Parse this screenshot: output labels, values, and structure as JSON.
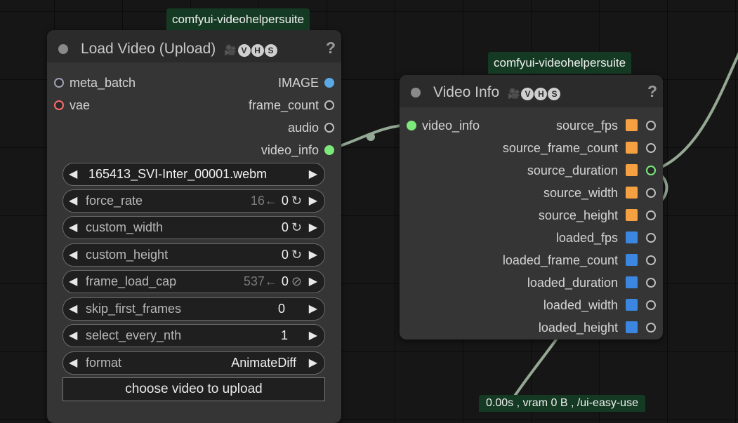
{
  "node_load": {
    "badge": "comfyui-videohelpersuite",
    "title": "Load Video (Upload)",
    "help": "?",
    "vhs_letters": [
      "V",
      "H",
      "S"
    ],
    "inputs": [
      "meta_batch",
      "vae"
    ],
    "outputs": [
      "IMAGE",
      "frame_count",
      "audio",
      "video_info"
    ],
    "widgets": {
      "video": "165413_SVI-Inter_00001.webm",
      "force_rate": {
        "label": "force_rate",
        "prev": "16←",
        "value": "0",
        "icon": "↻"
      },
      "custom_width": {
        "label": "custom_width",
        "value": "0",
        "icon": "↻"
      },
      "custom_height": {
        "label": "custom_height",
        "value": "0",
        "icon": "↻"
      },
      "frame_load_cap": {
        "label": "frame_load_cap",
        "prev": "537←",
        "value": "0",
        "icon": "⊘"
      },
      "skip_first_frames": {
        "label": "skip_first_frames",
        "value": "0"
      },
      "select_every_nth": {
        "label": "select_every_nth",
        "value": "1"
      },
      "format": {
        "label": "format",
        "value": "AnimateDiff"
      }
    },
    "upload_button": "choose video to upload"
  },
  "node_info": {
    "badge": "comfyui-videohelpersuite",
    "title": "Video Info",
    "help": "?",
    "vhs_letters": [
      "V",
      "H",
      "S"
    ],
    "input": "video_info",
    "outputs": [
      "source_fps",
      "source_frame_count",
      "source_duration",
      "source_width",
      "source_height",
      "loaded_fps",
      "loaded_frame_count",
      "loaded_duration",
      "loaded_width",
      "loaded_height"
    ]
  },
  "status_badge": "0.00s , vram 0 B , /ui-easy-use",
  "colors": {
    "image_slot": "#5aa9e6",
    "vae_slot": "#ff6b6b",
    "video_info_slot": "#7bea7b",
    "source_square": "#f5a142",
    "loaded_square": "#3a86e0",
    "wire": "#94a894",
    "badge_bg": "#153a23"
  }
}
